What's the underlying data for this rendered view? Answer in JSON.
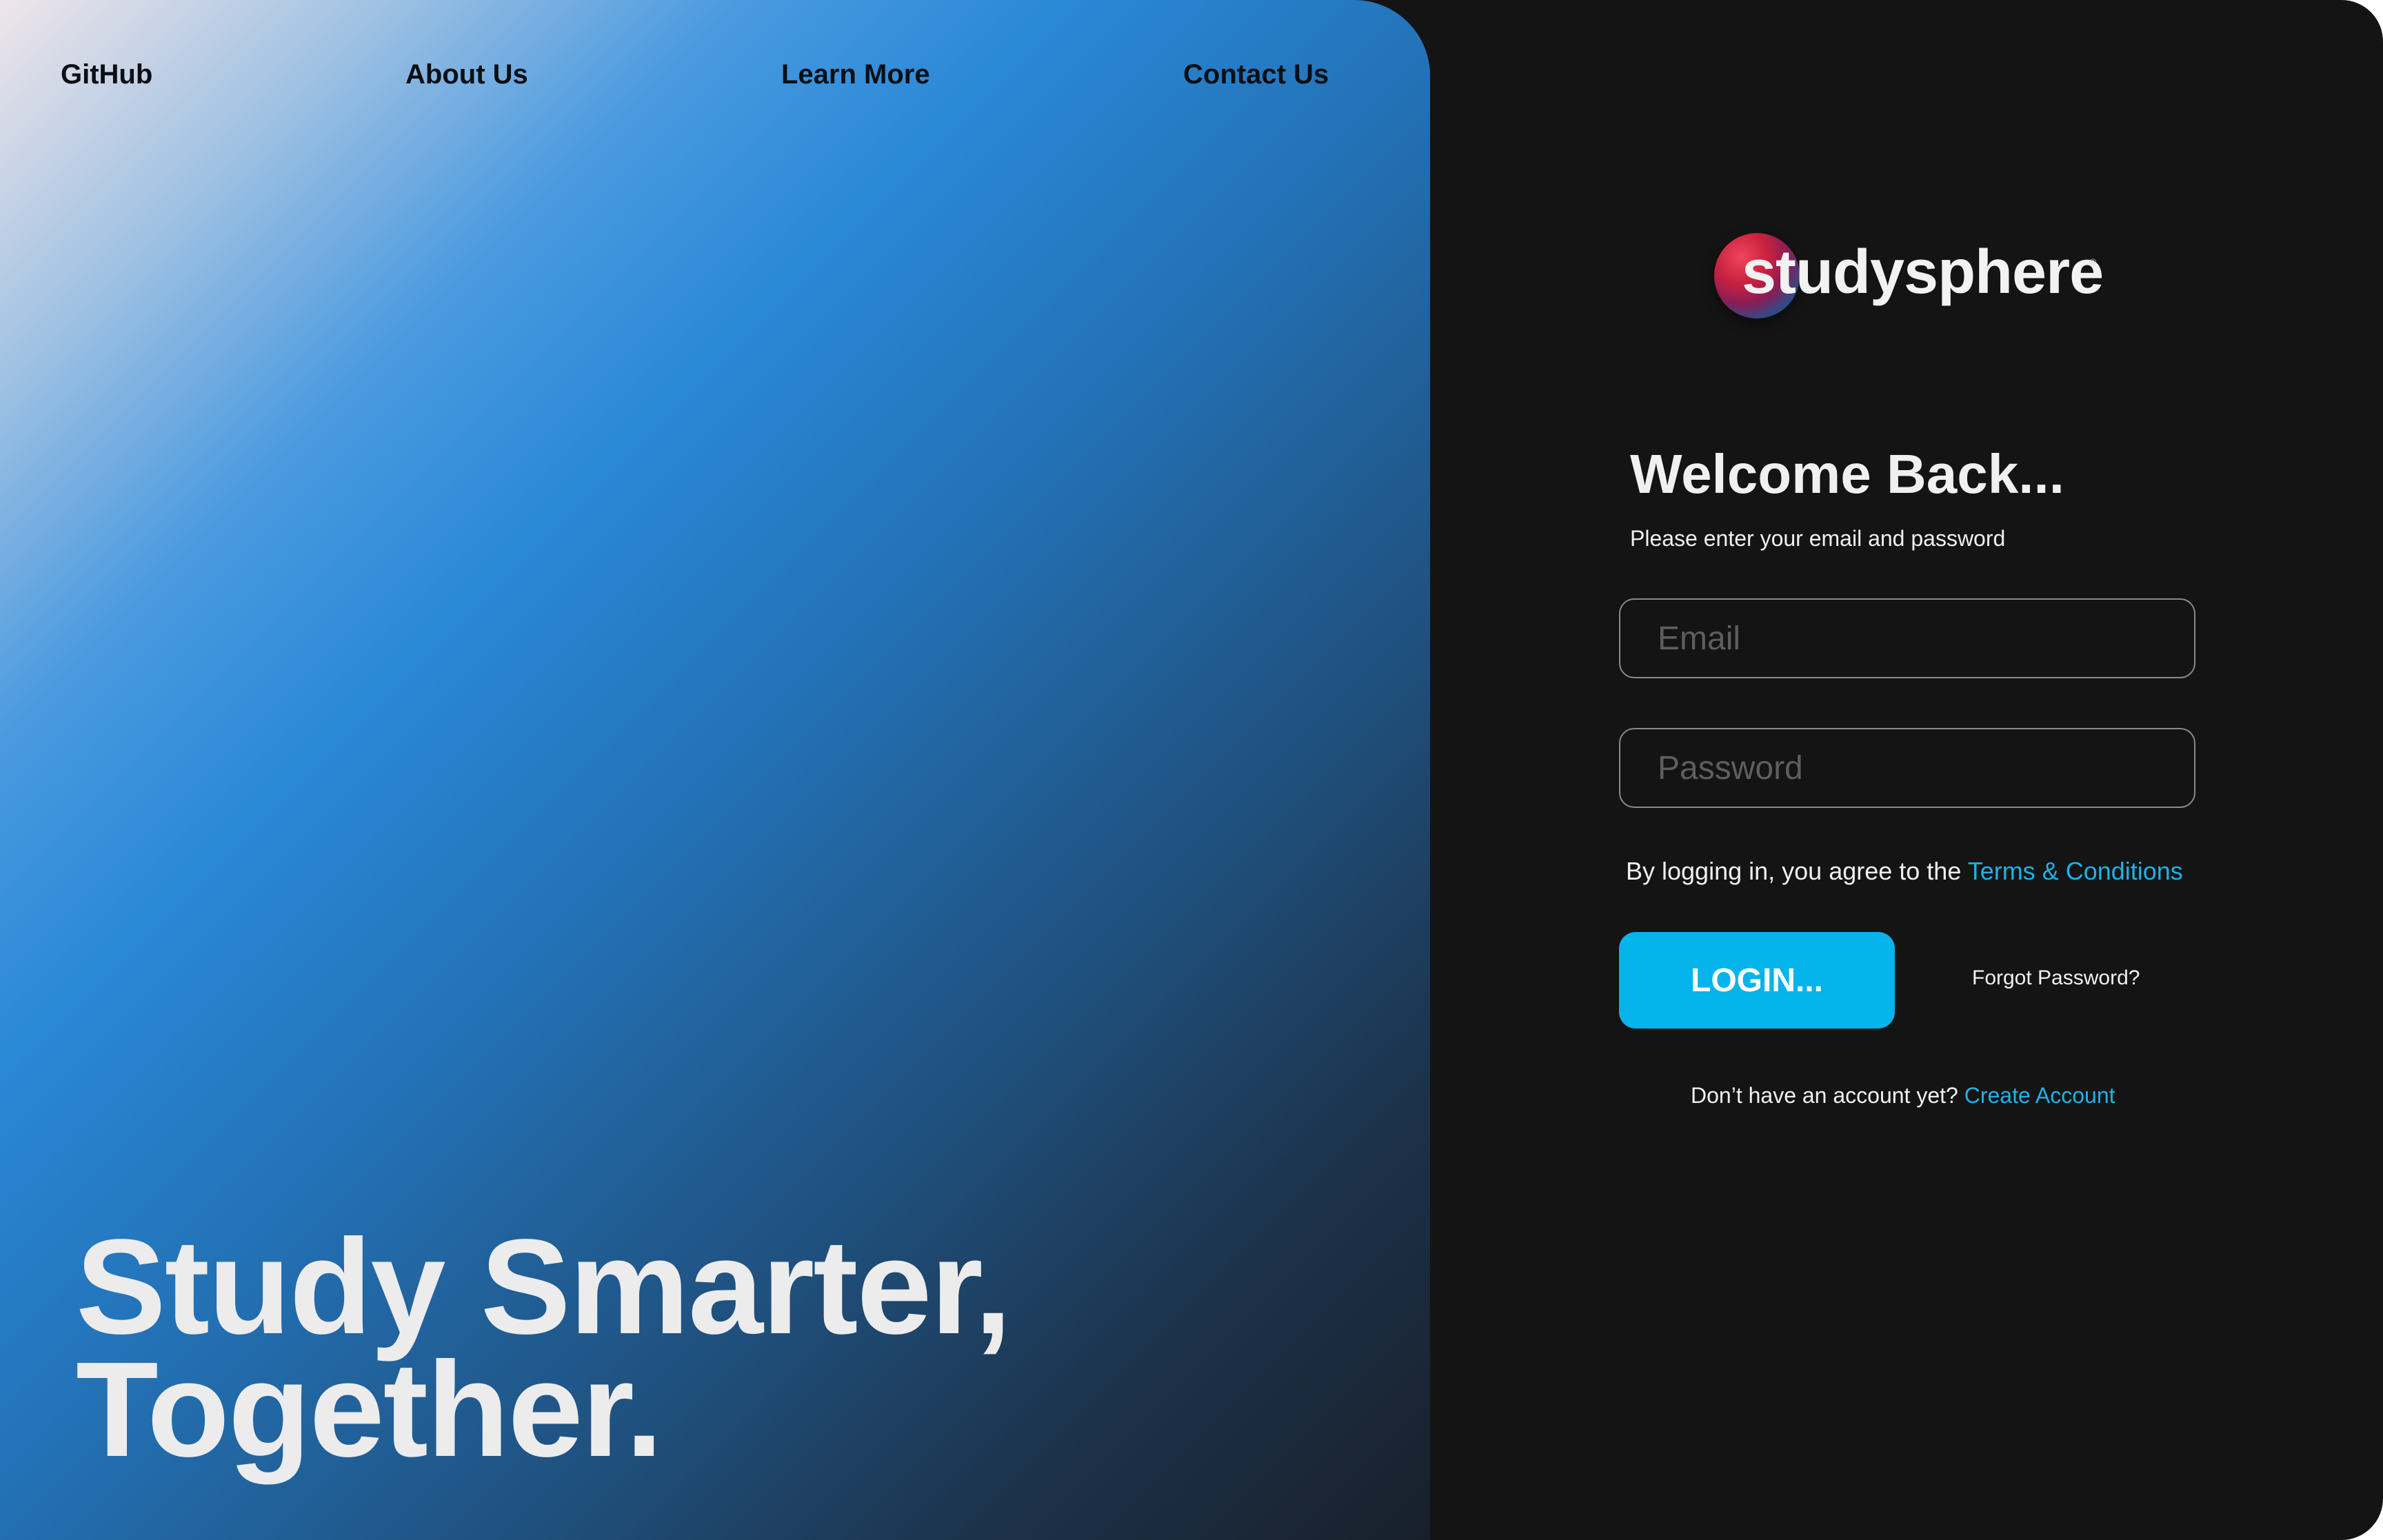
{
  "nav": {
    "github": "GitHub",
    "about": "About Us",
    "learn": "Learn More",
    "contact": "Contact Us"
  },
  "hero": {
    "line1": "Study Smarter,",
    "line2": "Together."
  },
  "brand": {
    "name": "studysphere",
    "registered": "®"
  },
  "login": {
    "title": "Welcome Back...",
    "subtitle": "Please enter your email and password",
    "email_placeholder": "Email",
    "email_value": "",
    "password_placeholder": "Password",
    "password_value": "",
    "terms_prefix": "By logging in, you agree to the ",
    "terms_link": "Terms & Conditions",
    "button": "LOGIN...",
    "forgot": "Forgot Password?",
    "signup_prefix": "Don’t have an account yet? ",
    "signup_link": "Create Account"
  },
  "colors": {
    "accent": "#05b4ea",
    "link": "#1fb2e6",
    "panel_bg": "#141414",
    "text_light": "#f0f0f0"
  }
}
